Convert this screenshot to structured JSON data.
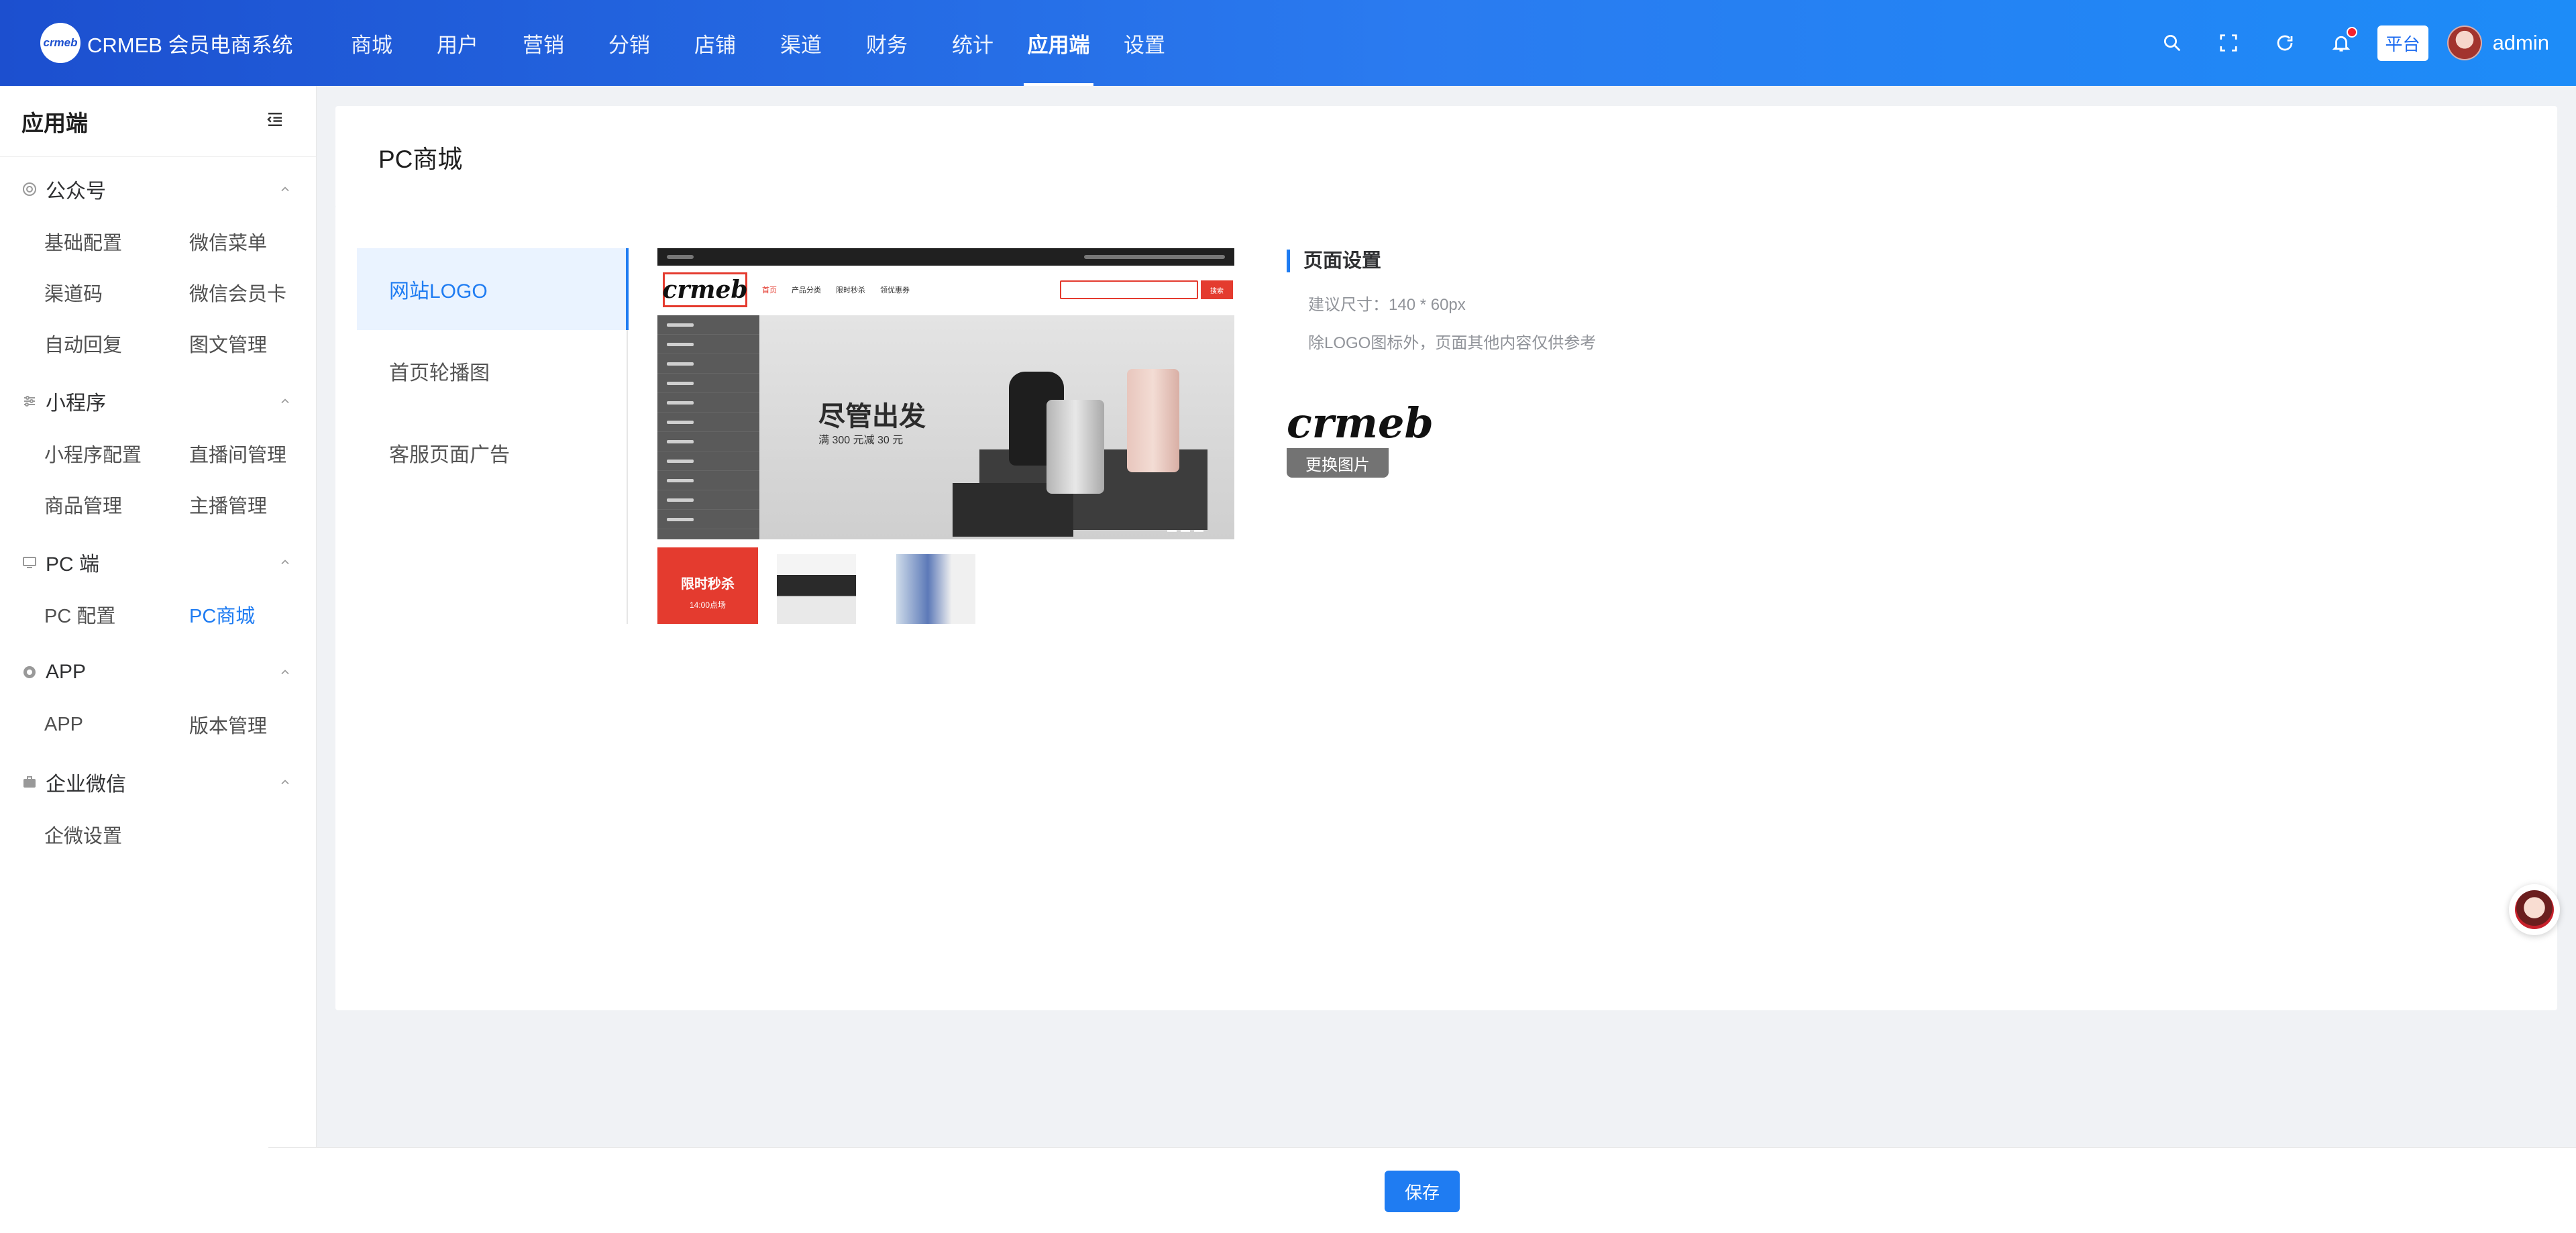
{
  "brand": {
    "title": "CRMEB 会员电商系统",
    "logo_text": "crmeb"
  },
  "nav": {
    "items": [
      {
        "label": "商城"
      },
      {
        "label": "用户"
      },
      {
        "label": "营销"
      },
      {
        "label": "分销"
      },
      {
        "label": "店铺"
      },
      {
        "label": "渠道"
      },
      {
        "label": "财务"
      },
      {
        "label": "统计"
      },
      {
        "label": "应用端",
        "active": true
      },
      {
        "label": "设置"
      }
    ]
  },
  "topbar": {
    "platform_badge": "平台",
    "username": "admin",
    "icons": [
      "search-icon",
      "fullscreen-icon",
      "refresh-icon",
      "bell-icon"
    ],
    "has_notification": true
  },
  "sidebar": {
    "title": "应用端",
    "groups": [
      {
        "label": "公众号",
        "icon": "wechat-icon",
        "items": [
          "基础配置",
          "微信菜单",
          "渠道码",
          "微信会员卡",
          "自动回复",
          "图文管理"
        ]
      },
      {
        "label": "小程序",
        "icon": "miniprogram-icon",
        "items": [
          "小程序配置",
          "直播间管理",
          "商品管理",
          "主播管理"
        ]
      },
      {
        "label": "PC 端",
        "icon": "monitor-icon",
        "items": [
          "PC 配置",
          "PC商城"
        ]
      },
      {
        "label": "APP",
        "icon": "app-icon",
        "items": [
          "APP",
          "版本管理"
        ]
      },
      {
        "label": "企业微信",
        "icon": "briefcase-icon",
        "items": [
          "企微设置"
        ]
      }
    ],
    "active_item": "PC商城"
  },
  "page": {
    "title": "PC商城"
  },
  "tabs": [
    {
      "label": "网站LOGO",
      "active": true
    },
    {
      "label": "首页轮播图"
    },
    {
      "label": "客服页面广告"
    }
  ],
  "preview": {
    "logo_text": "crmeb",
    "menu": [
      "首页",
      "产品分类",
      "限时秒杀",
      "领优惠券"
    ],
    "search_button": "搜索",
    "banner_slogan": "尽管出发",
    "banner_sub": "满 300 元减 30 元",
    "flash_sale": "限时秒杀",
    "flash_time": "14:00点场"
  },
  "settings": {
    "title": "页面设置",
    "hint_size": "建议尺寸：140 * 60px",
    "hint_note": "除LOGO图标外，页面其他内容仅供参考",
    "logo_text": "crmeb",
    "change_button": "更换图片"
  },
  "footer": {
    "save_label": "保存"
  },
  "colors": {
    "topbar_start": "#1c4fcf",
    "topbar_end": "#1d8cf8",
    "accent": "#1f7cf2",
    "preview_red": "#e43b2f"
  }
}
